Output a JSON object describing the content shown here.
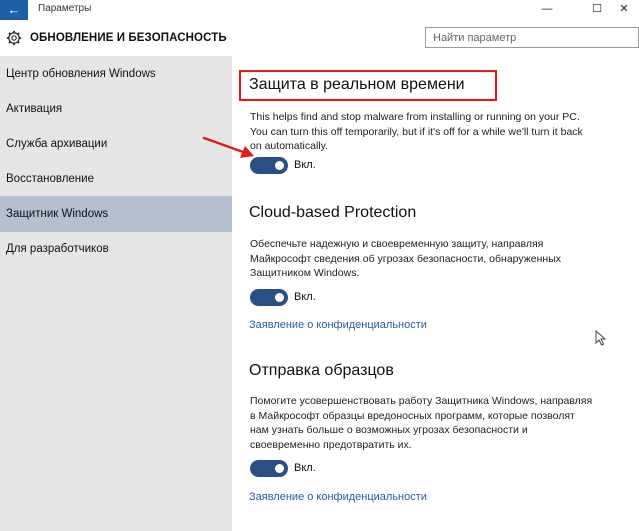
{
  "window": {
    "title": "Параметры",
    "back_glyph": "←",
    "min_glyph": "—",
    "max_glyph": "☐",
    "close_glyph": "✕"
  },
  "header": {
    "title": "ОБНОВЛЕНИЕ И БЕЗОПАСНОСТЬ",
    "search_placeholder": "Найти параметр"
  },
  "sidebar": {
    "items": [
      {
        "label": "Центр обновления Windows",
        "active": false
      },
      {
        "label": "Активация",
        "active": false
      },
      {
        "label": "Служба архивации",
        "active": false
      },
      {
        "label": "Восстановление",
        "active": false
      },
      {
        "label": "Защитник Windows",
        "active": true
      },
      {
        "label": "Для разработчиков",
        "active": false
      }
    ]
  },
  "main": {
    "realtime": {
      "title": "Защита в реальном времени",
      "description": "This helps find and stop malware from installing or running on your PC. You can turn this off temporarily, but if it's off for a while we'll turn it back on automatically.",
      "toggle_label": "Вкл."
    },
    "cloud": {
      "title": "Cloud-based Protection",
      "description": "Обеспечьте надежную и своевременную защиту, направляя Майкрософт сведения об угрозах безопасности, обнаруженных Защитником Windows.",
      "toggle_label": "Вкл.",
      "link": "Заявление о конфиденциальности"
    },
    "samples": {
      "title": "Отправка образцов",
      "description": "Помогите усовершенствовать работу Защитника Windows, направляя в Майкрософт образцы вредоносных программ, которые позволят нам узнать больше о возможных угрозах безопасности и своевременно предотвратить их.",
      "toggle_label": "Вкл.",
      "link": "Заявление о конфиденциальности"
    }
  },
  "colors": {
    "accent": "#1f5fa8",
    "toggle_on": "#2a4f84",
    "sidebar_bg": "#e6e6e6",
    "sidebar_active": "#b4bfcf",
    "highlight_border": "#e21a1a",
    "link": "#2b5c9a"
  },
  "icons": [
    "gear-icon",
    "red-arrow-icon",
    "mouse-cursor-icon"
  ]
}
